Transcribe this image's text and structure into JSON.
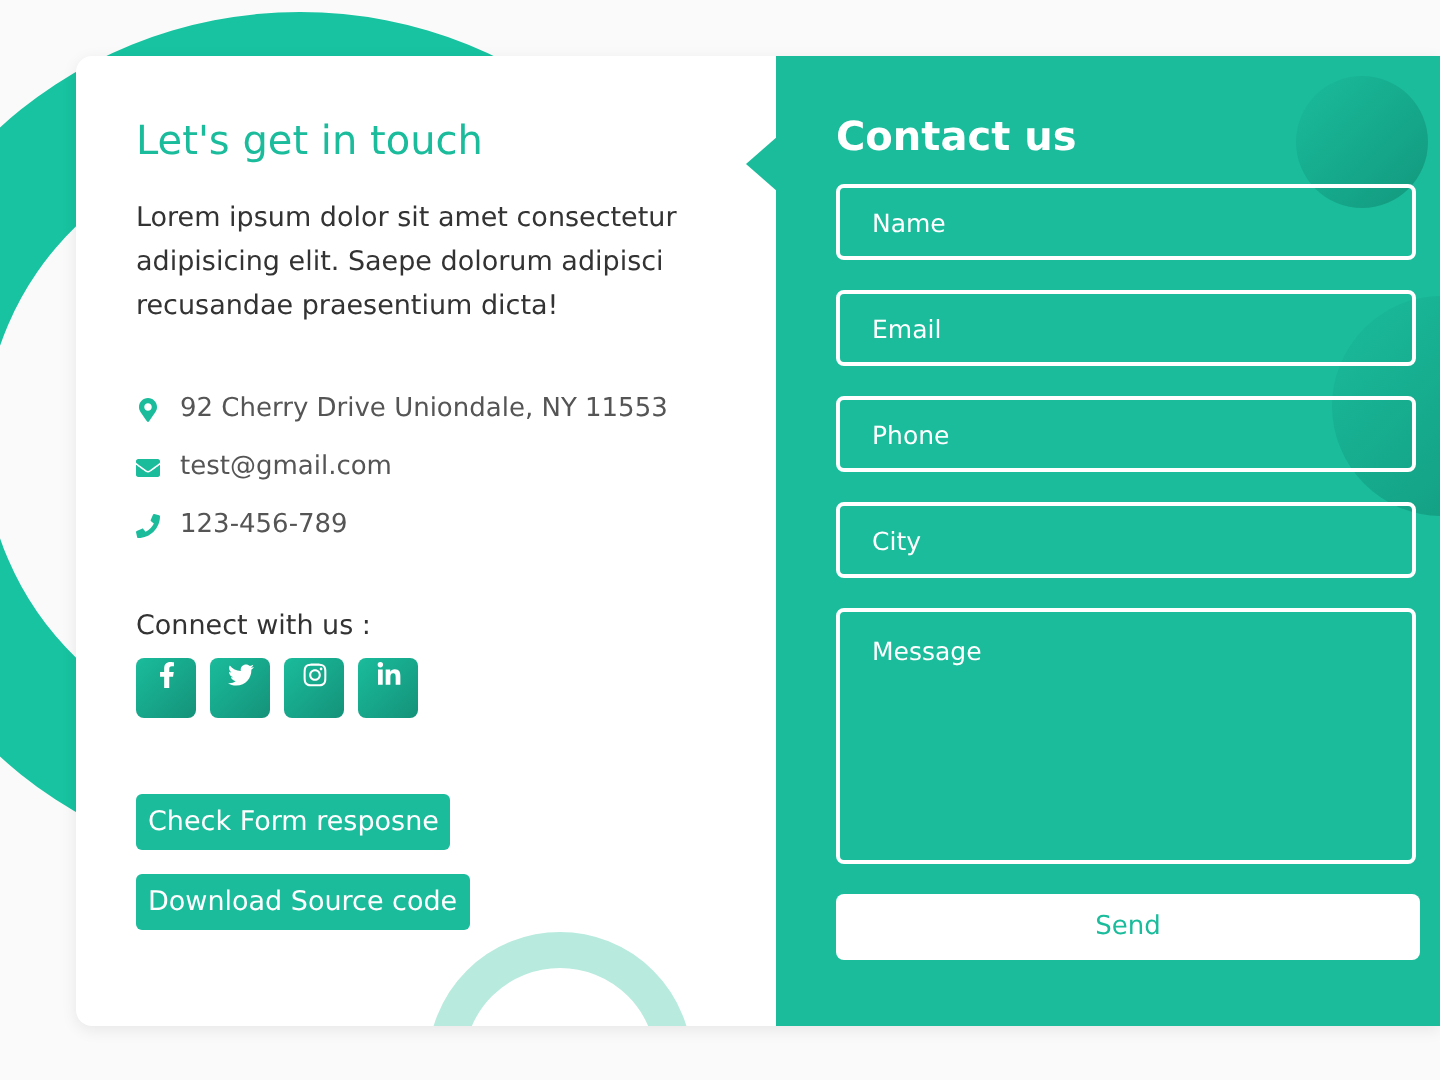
{
  "info": {
    "title": "Let's get in touch",
    "text": "Lorem ipsum dolor sit amet consectetur adipisicing elit. Saepe dolorum adipisci recusandae praesentium dicta!",
    "contacts": [
      {
        "kind": "address",
        "text": "92 Cherry Drive Uniondale, NY 11553"
      },
      {
        "kind": "email",
        "text": "test@gmail.com"
      },
      {
        "kind": "phone",
        "text": "123-456-789"
      }
    ],
    "social_label": "Connect with us :",
    "social": [
      {
        "kind": "facebook"
      },
      {
        "kind": "twitter"
      },
      {
        "kind": "instagram"
      },
      {
        "kind": "linkedin"
      }
    ],
    "buttons": [
      "Check Form resposne",
      "Download Source code"
    ]
  },
  "form": {
    "title": "Contact us",
    "fields": [
      {
        "kind": "line",
        "placeholder": "Name"
      },
      {
        "kind": "line",
        "placeholder": "Email"
      },
      {
        "kind": "line",
        "placeholder": "Phone"
      },
      {
        "kind": "line",
        "placeholder": "City"
      },
      {
        "kind": "area",
        "placeholder": "Message"
      }
    ],
    "submit": "Send"
  }
}
